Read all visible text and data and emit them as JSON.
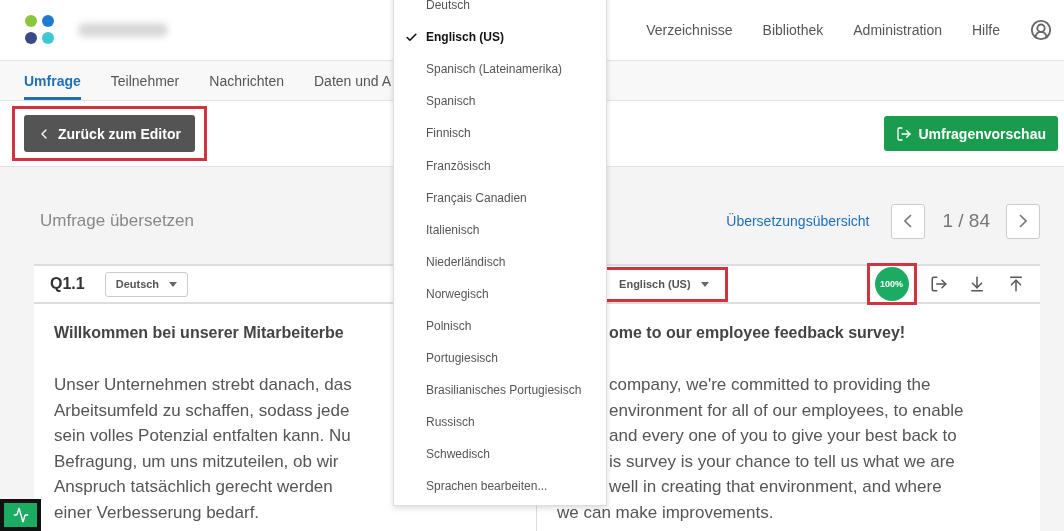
{
  "header": {
    "nav": [
      "Verzeichnisse",
      "Bibliothek",
      "Administration",
      "Hilfe"
    ]
  },
  "tabs": [
    {
      "label": "Umfrage",
      "selected": true
    },
    {
      "label": "Teilnehmer",
      "selected": false
    },
    {
      "label": "Nachrichten",
      "selected": false
    },
    {
      "label": "Daten und A",
      "selected": false
    }
  ],
  "back_button": {
    "label": "Zurück zum Editor",
    "highlighted": true
  },
  "preview_button": {
    "label": "Umfragenvorschau"
  },
  "page_title": "Umfrage übersetzen",
  "overview_link": "Übersetzungsübersicht",
  "pager": "1 / 84",
  "question": {
    "id": "Q1.1",
    "source_language": "Deutsch",
    "target_language": {
      "label": "Englisch (US)",
      "highlighted": true
    },
    "progress": {
      "label": "100%",
      "highlighted": true
    }
  },
  "source_text": {
    "heading": "Willkommen bei unserer Mitarbeiterbe",
    "lines": [
      "Unser Unternehmen strebt danach, das",
      "Arbeitsumfeld zu schaffen, sodass jede",
      "sein volles Potenzial entfalten kann. Nu",
      "Befragung, um uns mitzuteilen, ob wir",
      "Anspruch tatsächlich gerecht werden",
      "einer Verbesserung bedarf."
    ]
  },
  "target_text": {
    "heading": "ome to our employee feedback survey!",
    "lines": [
      "company, we're committed to providing the",
      "environment for all of our employees, to enable",
      "and every one of you to give your best back to",
      "is survey is your chance to tell us what we are",
      "well in creating that environment, and where",
      "we can make improvements."
    ]
  },
  "language_menu": {
    "items": [
      {
        "label": "Deutsch",
        "selected": false
      },
      {
        "label": "Englisch (US)",
        "selected": true
      },
      {
        "label": "Spanisch (Lateinamerika)",
        "selected": false
      },
      {
        "label": "Spanisch",
        "selected": false
      },
      {
        "label": "Finnisch",
        "selected": false
      },
      {
        "label": "Französisch",
        "selected": false
      },
      {
        "label": "Français Canadien",
        "selected": false
      },
      {
        "label": "Italienisch",
        "selected": false
      },
      {
        "label": "Niederländisch",
        "selected": false
      },
      {
        "label": "Norwegisch",
        "selected": false
      },
      {
        "label": "Polnisch",
        "selected": false
      },
      {
        "label": "Portugiesisch",
        "selected": false
      },
      {
        "label": "Brasilianisches Portugiesisch",
        "selected": false
      },
      {
        "label": "Russisch",
        "selected": false
      },
      {
        "label": "Schwedisch",
        "selected": false
      },
      {
        "label": "Sprachen bearbeiten...",
        "selected": false
      }
    ]
  }
}
